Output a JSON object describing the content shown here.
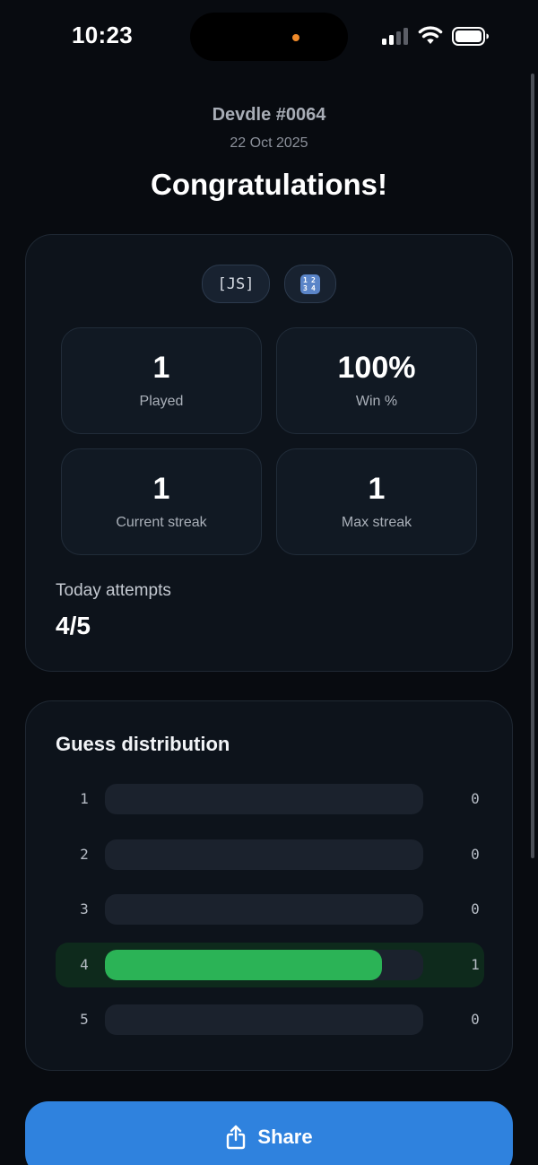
{
  "status_bar": {
    "time": "10:23",
    "icons": [
      "signal-icon",
      "wifi-icon",
      "battery-icon"
    ]
  },
  "header": {
    "puzzle_id": "Devdle #0064",
    "date": "22 Oct 2025",
    "title": "Congratulations!"
  },
  "tags": {
    "language": "[JS]",
    "numbers_icon": "numbers-icon",
    "numpad": [
      "1",
      "2",
      "3",
      "4"
    ]
  },
  "stats": {
    "played": {
      "value": "1",
      "label": "Played"
    },
    "win_pct": {
      "value": "100%",
      "label": "Win %"
    },
    "current_streak": {
      "value": "1",
      "label": "Current streak"
    },
    "max_streak": {
      "value": "1",
      "label": "Max streak"
    }
  },
  "today": {
    "label": "Today attempts",
    "value": "4/5"
  },
  "distribution": {
    "title": "Guess distribution",
    "rows": [
      {
        "guess": "1",
        "count": "0",
        "fill": 0
      },
      {
        "guess": "2",
        "count": "0",
        "fill": 0
      },
      {
        "guess": "3",
        "count": "0",
        "fill": 0
      },
      {
        "guess": "4",
        "count": "1",
        "fill": 0.87,
        "current": true
      },
      {
        "guess": "5",
        "count": "0",
        "fill": 0
      }
    ]
  },
  "share": {
    "label": "Share",
    "icon": "share-icon"
  },
  "colors": {
    "background": "#080b10",
    "accent_blue": "#2f82de",
    "bar_green": "#2bb356",
    "highlight_row": "#0e2a1c"
  }
}
